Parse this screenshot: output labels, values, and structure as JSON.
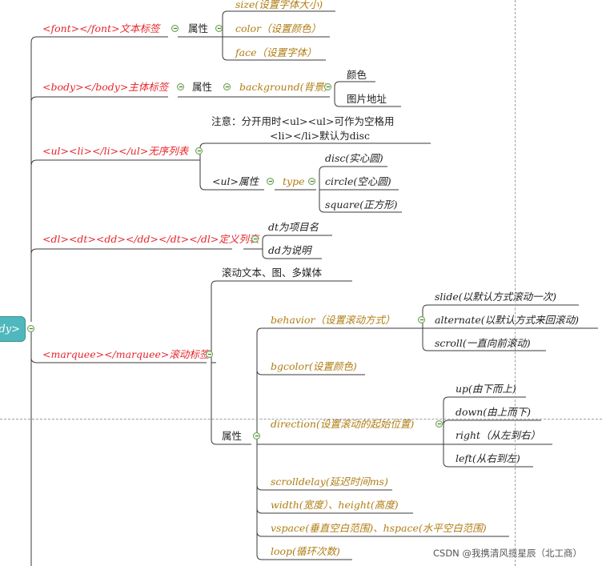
{
  "root": {
    "label": "dy>"
  },
  "font": {
    "tag": "<font></font>文本标签",
    "attr": "属性",
    "items": [
      "size(设置字体大小)",
      "color（设置颜色）",
      "face（设置字体）"
    ]
  },
  "body": {
    "tag": "<body></body>主体标签",
    "attr": "属性",
    "background": "background(背景)",
    "items": [
      "颜色",
      "图片地址"
    ]
  },
  "ul": {
    "tag": "<ul><li></li></ul>无序列表",
    "note_line1": "注意：分开用时<ul><ul>可作为空格用",
    "note_line2": "<li></li>默认为disc",
    "attr": "<ul>属性",
    "type": "type",
    "items": [
      "disc(实心圆)",
      "circle(空心圆)",
      "square(正方形)"
    ]
  },
  "dl": {
    "tag": "<dl><dt><dd></dd></dt></dl>定义列表",
    "items": [
      "dt为项目名",
      "dd为说明"
    ]
  },
  "marquee": {
    "tag": "<marquee></marquee>滚动标签",
    "desc": "滚动文本、图、多媒体",
    "attr": "属性",
    "behavior": "behavior（设置滚动方式）",
    "behavior_items": [
      "slide(以默认方式滚动一次)",
      "alternate(以默认方式来回滚动)",
      "scroll(一直向前滚动)"
    ],
    "bgcolor": "bgcolor(设置颜色)",
    "direction": "direction(设置滚动的起始位置)",
    "direction_items": [
      "up(由下而上)",
      "down(由上而下)",
      "right（从左到右）",
      "left(从右到左)"
    ],
    "scrolldelay": "scrolldelay(延迟时间ms)",
    "size": "width(宽度）、height(高度)",
    "space": "vspace(垂直空白范围)、hspace(水平空白范围)",
    "loop": "loop(循环次数)"
  },
  "watermark": "CSDN @我携清风揽星辰（北工商）"
}
